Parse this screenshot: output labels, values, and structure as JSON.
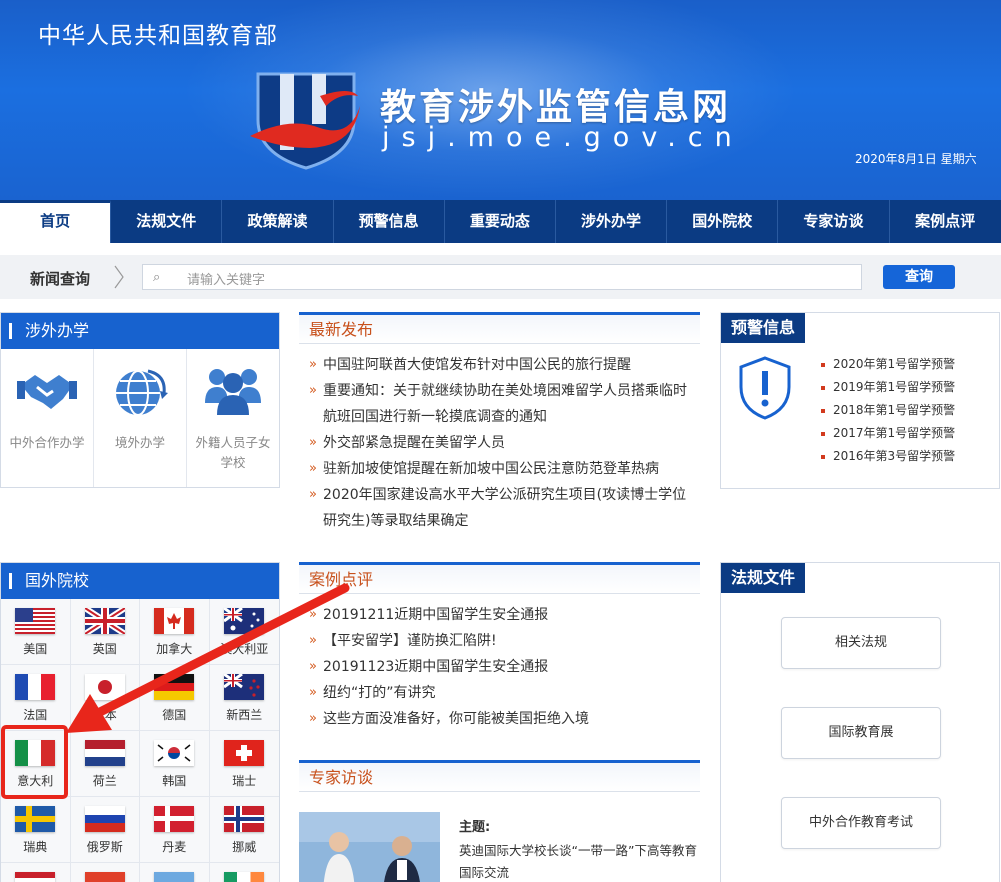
{
  "header": {
    "ministry": "中华人民共和国教育部",
    "site_title": "教育涉外监管信息网",
    "site_domain": "jsj.moe.gov.cn",
    "date": "2020年8月1日  星期六"
  },
  "nav": {
    "items": [
      {
        "label": "首页",
        "active": true
      },
      {
        "label": "法规文件"
      },
      {
        "label": "政策解读"
      },
      {
        "label": "预警信息"
      },
      {
        "label": "重要动态"
      },
      {
        "label": "涉外办学"
      },
      {
        "label": "国外院校"
      },
      {
        "label": "专家访谈"
      },
      {
        "label": "案例点评"
      }
    ]
  },
  "search": {
    "label": "新闻查询",
    "placeholder": "请输入关键字",
    "button": "查询"
  },
  "foreign_affairs": {
    "title": "涉外办学",
    "items": [
      {
        "label": "中外合作办学",
        "icon": "handshake-icon"
      },
      {
        "label": "境外办学",
        "icon": "globe-icon"
      },
      {
        "label": "外籍人员子女学校",
        "icon": "people-icon"
      }
    ]
  },
  "foreign_schools": {
    "title": "国外院校",
    "countries": [
      {
        "name": "美国",
        "flag": "us"
      },
      {
        "name": "英国",
        "flag": "uk"
      },
      {
        "name": "加拿大",
        "flag": "ca"
      },
      {
        "name": "澳大利亚",
        "flag": "au"
      },
      {
        "name": "法国",
        "flag": "fr"
      },
      {
        "name": "日本",
        "flag": "jp"
      },
      {
        "name": "德国",
        "flag": "de"
      },
      {
        "name": "新西兰",
        "flag": "nz"
      },
      {
        "name": "意大利",
        "flag": "it"
      },
      {
        "name": "荷兰",
        "flag": "nl"
      },
      {
        "name": "韩国",
        "flag": "kr"
      },
      {
        "name": "瑞士",
        "flag": "ch"
      },
      {
        "name": "瑞典",
        "flag": "se"
      },
      {
        "name": "俄罗斯",
        "flag": "ru"
      },
      {
        "name": "丹麦",
        "flag": "dk"
      },
      {
        "name": "挪威",
        "flag": "no"
      }
    ]
  },
  "latest": {
    "title": "最新发布",
    "items": [
      "中国驻阿联酋大使馆发布针对中国公民的旅行提醒",
      "重要通知：关于就继续协助在美处境困难留学人员搭乘临时航班回国进行新一轮摸底调查的通知",
      "外交部紧急提醒在美留学人员",
      "驻新加坡使馆提醒在新加坡中国公民注意防范登革热病",
      "2020年国家建设高水平大学公派研究生项目(攻读博士学位研究生)等录取结果确定"
    ]
  },
  "cases": {
    "title": "案例点评",
    "items": [
      "20191211近期中国留学生安全通报",
      "【平安留学】谨防换汇陷阱!",
      "20191123近期中国留学生安全通报",
      "纽约“打的”有讲究",
      "这些方面没准备好，你可能被美国拒绝入境"
    ]
  },
  "experts": {
    "title": "专家访谈",
    "theme_label": "主题:",
    "theme_text": "英迪国际大学校长谈“一带一路”下高等教育国际交流"
  },
  "warnings": {
    "title": "预警信息",
    "items": [
      "2020年第1号留学预警",
      "2019年第1号留学预警",
      "2018年第1号留学预警",
      "2017年第1号留学预警",
      "2016年第3号留学预警"
    ]
  },
  "laws": {
    "title": "法规文件",
    "buttons": [
      "相关法规",
      "国际教育展",
      "中外合作教育考试"
    ]
  },
  "colors": {
    "brand_blue": "#1762cf",
    "nav_dark": "#0b3b83",
    "accent_orange": "#c8511c",
    "annotation_red": "#e8261b"
  }
}
